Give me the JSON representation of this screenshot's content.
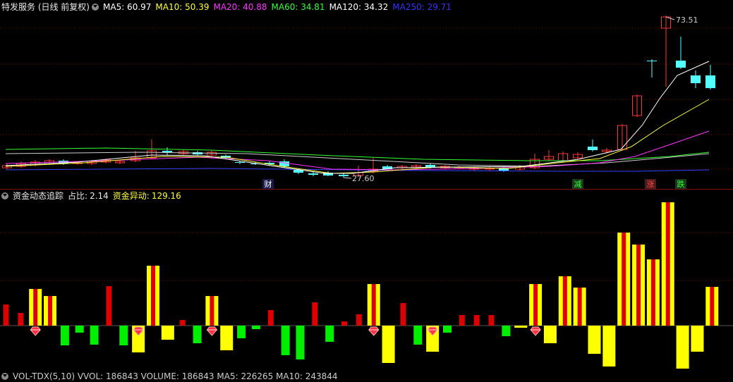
{
  "price_panel": {
    "title": "特发服务 (日线 前复权)",
    "ma": [
      {
        "label": "MA5: 60.97",
        "color": "#ffffff"
      },
      {
        "label": "MA10: 50.39",
        "color": "#ffff33"
      },
      {
        "label": "MA20: 40.88",
        "color": "#ff33ff"
      },
      {
        "label": "MA60: 34.81",
        "color": "#33ff33"
      },
      {
        "label": "MA120: 34.32",
        "color": "#ffffff"
      },
      {
        "label": "MA250: 29.71",
        "color": "#3333ff"
      }
    ],
    "high_label": "73.51",
    "low_label": "27.60",
    "markers": [
      {
        "text": "财",
        "color": "#ffffff",
        "bg": "#1b1b4a"
      },
      {
        "text": "减",
        "color": "#33ff33",
        "bg": "#1b3a1b"
      },
      {
        "text": "涨",
        "color": "#ff4444",
        "bg": "#4a1b1b"
      },
      {
        "text": "跌",
        "color": "#33ff33",
        "bg": "#1b3a1b"
      }
    ],
    "colors": {
      "up": "#ff3333",
      "down": "#54ffff",
      "grid": "#8b0000"
    }
  },
  "indicator_panel": {
    "title": "资金动态追踪",
    "ratio_label": "占比:",
    "ratio_value": "2.14",
    "flow_label": "资金异动:",
    "flow_value": "129.16",
    "bars": [
      {
        "v": 30,
        "t": "r"
      },
      {
        "v": 18,
        "t": "r"
      },
      {
        "v": 52,
        "t": "y",
        "g": 1
      },
      {
        "v": 42,
        "t": "y"
      },
      {
        "v": -28,
        "t": "g"
      },
      {
        "v": -10,
        "t": "g"
      },
      {
        "v": -27,
        "t": "g"
      },
      {
        "v": 56,
        "t": "r"
      },
      {
        "v": -28,
        "t": "g"
      },
      {
        "v": -38,
        "t": "y",
        "g": 1
      },
      {
        "v": 85,
        "t": "y"
      },
      {
        "v": -20,
        "t": "y"
      },
      {
        "v": 8,
        "t": "r"
      },
      {
        "v": -25,
        "t": "g"
      },
      {
        "v": 42,
        "t": "y",
        "g": 1
      },
      {
        "v": -35,
        "t": "y"
      },
      {
        "v": -18,
        "t": "g"
      },
      {
        "v": -5,
        "t": "g"
      },
      {
        "v": 22,
        "t": "r"
      },
      {
        "v": -42,
        "t": "g"
      },
      {
        "v": -48,
        "t": "g"
      },
      {
        "v": 33,
        "t": "r"
      },
      {
        "v": -23,
        "t": "g"
      },
      {
        "v": 6,
        "t": "r"
      },
      {
        "v": 16,
        "t": "r"
      },
      {
        "v": 59,
        "t": "y",
        "g": 1
      },
      {
        "v": -53,
        "t": "y"
      },
      {
        "v": 32,
        "t": "r"
      },
      {
        "v": -27,
        "t": "g"
      },
      {
        "v": -37,
        "t": "y",
        "g": 1
      },
      {
        "v": -10,
        "t": "g"
      },
      {
        "v": 15,
        "t": "r"
      },
      {
        "v": 15,
        "t": "r"
      },
      {
        "v": 15,
        "t": "r"
      },
      {
        "v": -15,
        "t": "g"
      },
      {
        "v": -3,
        "t": "y"
      },
      {
        "v": 59,
        "t": "y",
        "g": 1
      },
      {
        "v": -25,
        "t": "y"
      },
      {
        "v": 70,
        "t": "y"
      },
      {
        "v": 54,
        "t": "y"
      },
      {
        "v": -40,
        "t": "y"
      },
      {
        "v": -58,
        "t": "y"
      },
      {
        "v": 132,
        "t": "y"
      },
      {
        "v": 115,
        "t": "y"
      },
      {
        "v": 94,
        "t": "y"
      },
      {
        "v": 175,
        "t": "y"
      },
      {
        "v": -61,
        "t": "y"
      },
      {
        "v": -37,
        "t": "y"
      },
      {
        "v": 55,
        "t": "y"
      }
    ]
  },
  "volume_panel": {
    "text": "VOL-TDX(5,10)  VVOL: 186843  VOLUME: 186843  MA5: 226265  MA10: 243844"
  }
}
